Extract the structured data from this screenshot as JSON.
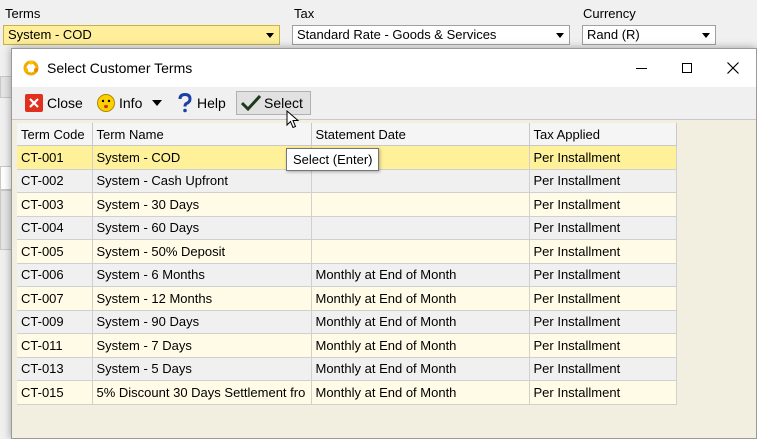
{
  "form": {
    "terms": {
      "label": "Terms",
      "value": "System - COD"
    },
    "tax": {
      "label": "Tax",
      "value": "Standard Rate - Goods & Services"
    },
    "currency": {
      "label": "Currency",
      "value": "Rand (R)"
    }
  },
  "dialog": {
    "title": "Select Customer Terms",
    "toolbar": {
      "close": "Close",
      "info": "Info",
      "help": "Help",
      "select": "Select"
    },
    "tooltip": "Select (Enter)",
    "columns": [
      "Term Code",
      "Term Name",
      "Statement Date",
      "Tax Applied"
    ],
    "rows": [
      {
        "code": "CT-001",
        "name": "System - COD",
        "statement": "",
        "tax": "Per Installment"
      },
      {
        "code": "CT-002",
        "name": "System - Cash Upfront",
        "statement": "",
        "tax": "Per Installment"
      },
      {
        "code": "CT-003",
        "name": "System - 30 Days",
        "statement": "",
        "tax": "Per Installment"
      },
      {
        "code": "CT-004",
        "name": "System - 60 Days",
        "statement": "",
        "tax": "Per Installment"
      },
      {
        "code": "CT-005",
        "name": "System - 50% Deposit",
        "statement": "",
        "tax": "Per Installment"
      },
      {
        "code": "CT-006",
        "name": "System - 6 Months",
        "statement": "Monthly at End of Month",
        "tax": "Per Installment"
      },
      {
        "code": "CT-007",
        "name": "System - 12 Months",
        "statement": "Monthly at End of Month",
        "tax": "Per Installment"
      },
      {
        "code": "CT-009",
        "name": "System - 90 Days",
        "statement": "Monthly at End of Month",
        "tax": "Per Installment"
      },
      {
        "code": "CT-011",
        "name": "System - 7 Days",
        "statement": "Monthly at End of Month",
        "tax": "Per Installment"
      },
      {
        "code": "CT-013",
        "name": "System - 5 Days",
        "statement": "Monthly at End of Month",
        "tax": "Per Installment"
      },
      {
        "code": "CT-015",
        "name": "5% Discount 30 Days Settlement fro",
        "statement": "Monthly at End of Month",
        "tax": "Per Installment"
      }
    ]
  },
  "colors": {
    "selected_row": "#fff09a",
    "row_alt": "#fffbe6",
    "field_highlight": "#ffef9a"
  }
}
